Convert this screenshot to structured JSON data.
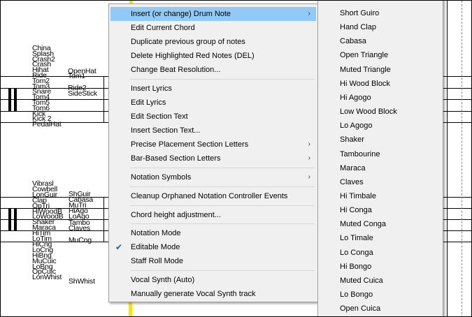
{
  "staff": {
    "upper_labels": [
      "China",
      "Splash",
      "Crash2",
      "Crash",
      "Hihat",
      "Ride",
      "Tom2",
      "Tom3",
      "Snare",
      "Tom4",
      "Tom5",
      "Tom6",
      "Kick",
      "Kick 2",
      "PedalHat"
    ],
    "upper_labels_right": [
      "OpenHat",
      "Tom1",
      "Ride2",
      "SideStick"
    ],
    "lower_labels": [
      "Vibrasl",
      "Cowbell",
      "LonGuir",
      "Clap",
      "OpTri",
      "HiWoodB",
      "LoWoodB",
      "Shaker",
      "Maraca",
      "HiTim",
      "LoTim",
      "HiCng",
      "LoCng",
      "HiBng",
      "MuCuic",
      "LoBng",
      "OpCuic",
      "LonWhist"
    ],
    "lower_labels_right": [
      "ShGuir",
      "Cabasa",
      "MuTri",
      "HiAgo",
      "LoAgo",
      "Tambo",
      "Claves",
      "MuCng",
      "ShWhist"
    ]
  },
  "menu": {
    "items": [
      {
        "label": "Insert (or change) Drum Note",
        "submenu": true,
        "highlighted": true
      },
      {
        "label": "Edit Current Chord"
      },
      {
        "label": "Duplicate previous group of notes"
      },
      {
        "label": "Delete Highlighted Red Notes  (DEL)"
      },
      {
        "label": "Change Beat Resolution..."
      },
      {
        "label": "Insert Lyrics"
      },
      {
        "label": "Edit Lyrics"
      },
      {
        "label": "Edit Section Text"
      },
      {
        "label": "Insert Section Text..."
      },
      {
        "label": "Precise Placement Section Letters",
        "submenu": true
      },
      {
        "label": "Bar-Based Section Letters",
        "submenu": true
      },
      {
        "label": "Notation Symbols",
        "submenu": true
      },
      {
        "label": "Cleanup Orphaned Notation Controller Events"
      },
      {
        "label": "Chord height adjustment..."
      },
      {
        "label": "Notation Mode"
      },
      {
        "label": "Editable Mode",
        "checked": true
      },
      {
        "label": "Staff Roll Mode"
      },
      {
        "label": "Vocal Synth (Auto)"
      },
      {
        "label": "Manually generate Vocal Synth track"
      }
    ],
    "arrow_glyph": "›",
    "check_glyph": "✔"
  },
  "submenu": {
    "items": [
      "Short Guiro",
      "Hand Clap",
      "Cabasa",
      "Open Triangle",
      "Muted Triangle",
      "Hi Wood Block",
      "Hi Agogo",
      "Low Wood Block",
      "Lo Agogo",
      "Shaker",
      "Tambourine",
      "Maraca",
      "Claves",
      "Hi Timbale",
      "Hi Conga",
      "Muted Conga",
      "Lo Timale",
      "Lo Conga",
      "Hi Bongo",
      "Muted Cuica",
      "Lo Bongo",
      "Open Cuica"
    ]
  }
}
